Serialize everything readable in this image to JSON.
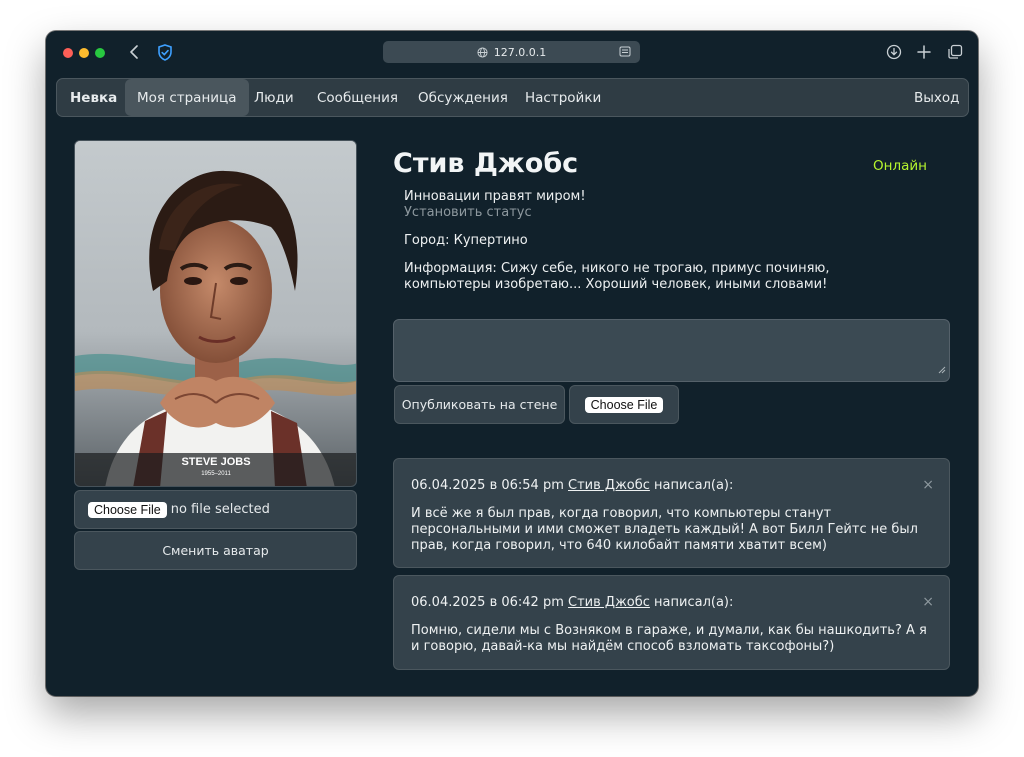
{
  "browser": {
    "url": "127.0.0.1"
  },
  "nav": {
    "brand": "Невка",
    "items": [
      "Моя страница",
      "Люди",
      "Сообщения",
      "Обсуждения",
      "Настройки"
    ],
    "logout": "Выход"
  },
  "profile": {
    "name": "Стив Джобс",
    "online": "Онлайн",
    "status": "Инновации правят миром!",
    "set_status": "Установить статус",
    "city": "Город: Купертино",
    "info": "Информация: Сижу себе, никого не трогаю, примус починяю, компьютеры изобретаю... Хороший человек, иными словами!",
    "photo_caption": "STEVE JOBS",
    "photo_years": "1955–2011"
  },
  "avatar_upload": {
    "choose_file": "Choose File",
    "no_file": "no file selected",
    "submit": "Сменить аватар"
  },
  "wall_form": {
    "publish": "Опубликовать на стене",
    "choose_file": "Choose File"
  },
  "posts": [
    {
      "date": "06.04.2025 в 06:54 pm",
      "author": "Стив Джобс",
      "suffix": "написал(а):",
      "close": "×",
      "text": "И всё же я был прав, когда говорил, что компьютеры станут персональными и ими сможет владеть каждый! А вот Билл Гейтс не был прав, когда говорил, что 640 килобайт памяти хватит всем)"
    },
    {
      "date": "06.04.2025 в 06:42 pm",
      "author": "Стив Джобс",
      "suffix": "написал(а):",
      "close": "×",
      "text": "Помню, сидели мы с Возняком в гараже, и думали, как бы нашкодить? А я и говорю, давай-ка мы найдём способ взломать таксофоны?)"
    }
  ],
  "colors": {
    "background": "#11212b",
    "panel": "#34424b",
    "online": "#b6f52e"
  }
}
